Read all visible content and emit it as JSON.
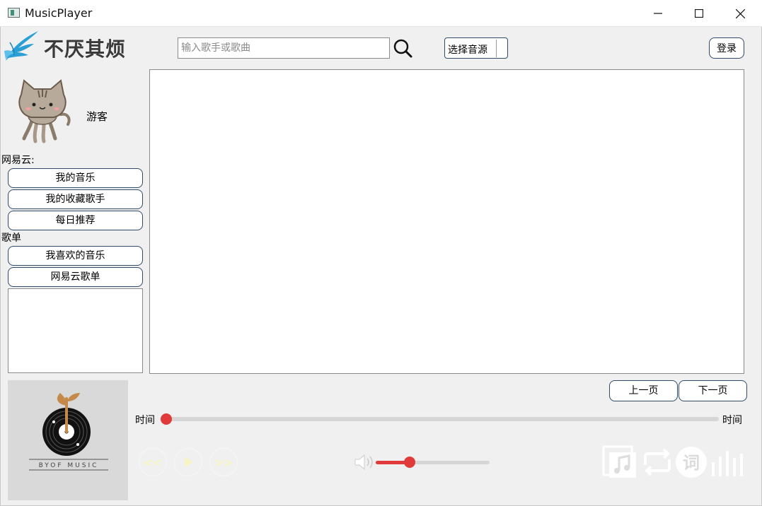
{
  "window": {
    "title": "MusicPlayer"
  },
  "header": {
    "logo_text": "不厌其烦",
    "search": {
      "placeholder": "输入歌手或歌曲",
      "value": ""
    },
    "source_select": "选择音源",
    "login_label": "登录"
  },
  "user": {
    "name": "游客"
  },
  "sidebar": {
    "section_netease": "网易云:",
    "netease_items": [
      "我的音乐",
      "我的收藏歌手",
      "每日推荐"
    ],
    "section_playlist": "歌单",
    "playlist_items": [
      "我喜欢的音乐",
      "网易云歌单"
    ]
  },
  "cover": {
    "brand_text": "BYOF MUSIC"
  },
  "pager": {
    "prev_label": "上一页",
    "next_label": "下一页"
  },
  "player": {
    "time_left": "时间",
    "time_right": "时间",
    "progress": 0,
    "volume": 0.3,
    "prev_symbol": "<<",
    "next_symbol": ">>",
    "lyrics_glyph": "词",
    "accent_color": "#e03a3a",
    "icons": [
      "prev-icon",
      "play-icon",
      "next-icon",
      "volume-icon",
      "playlist-icon",
      "repeat-icon",
      "lyrics-icon",
      "equalizer-icon"
    ]
  }
}
